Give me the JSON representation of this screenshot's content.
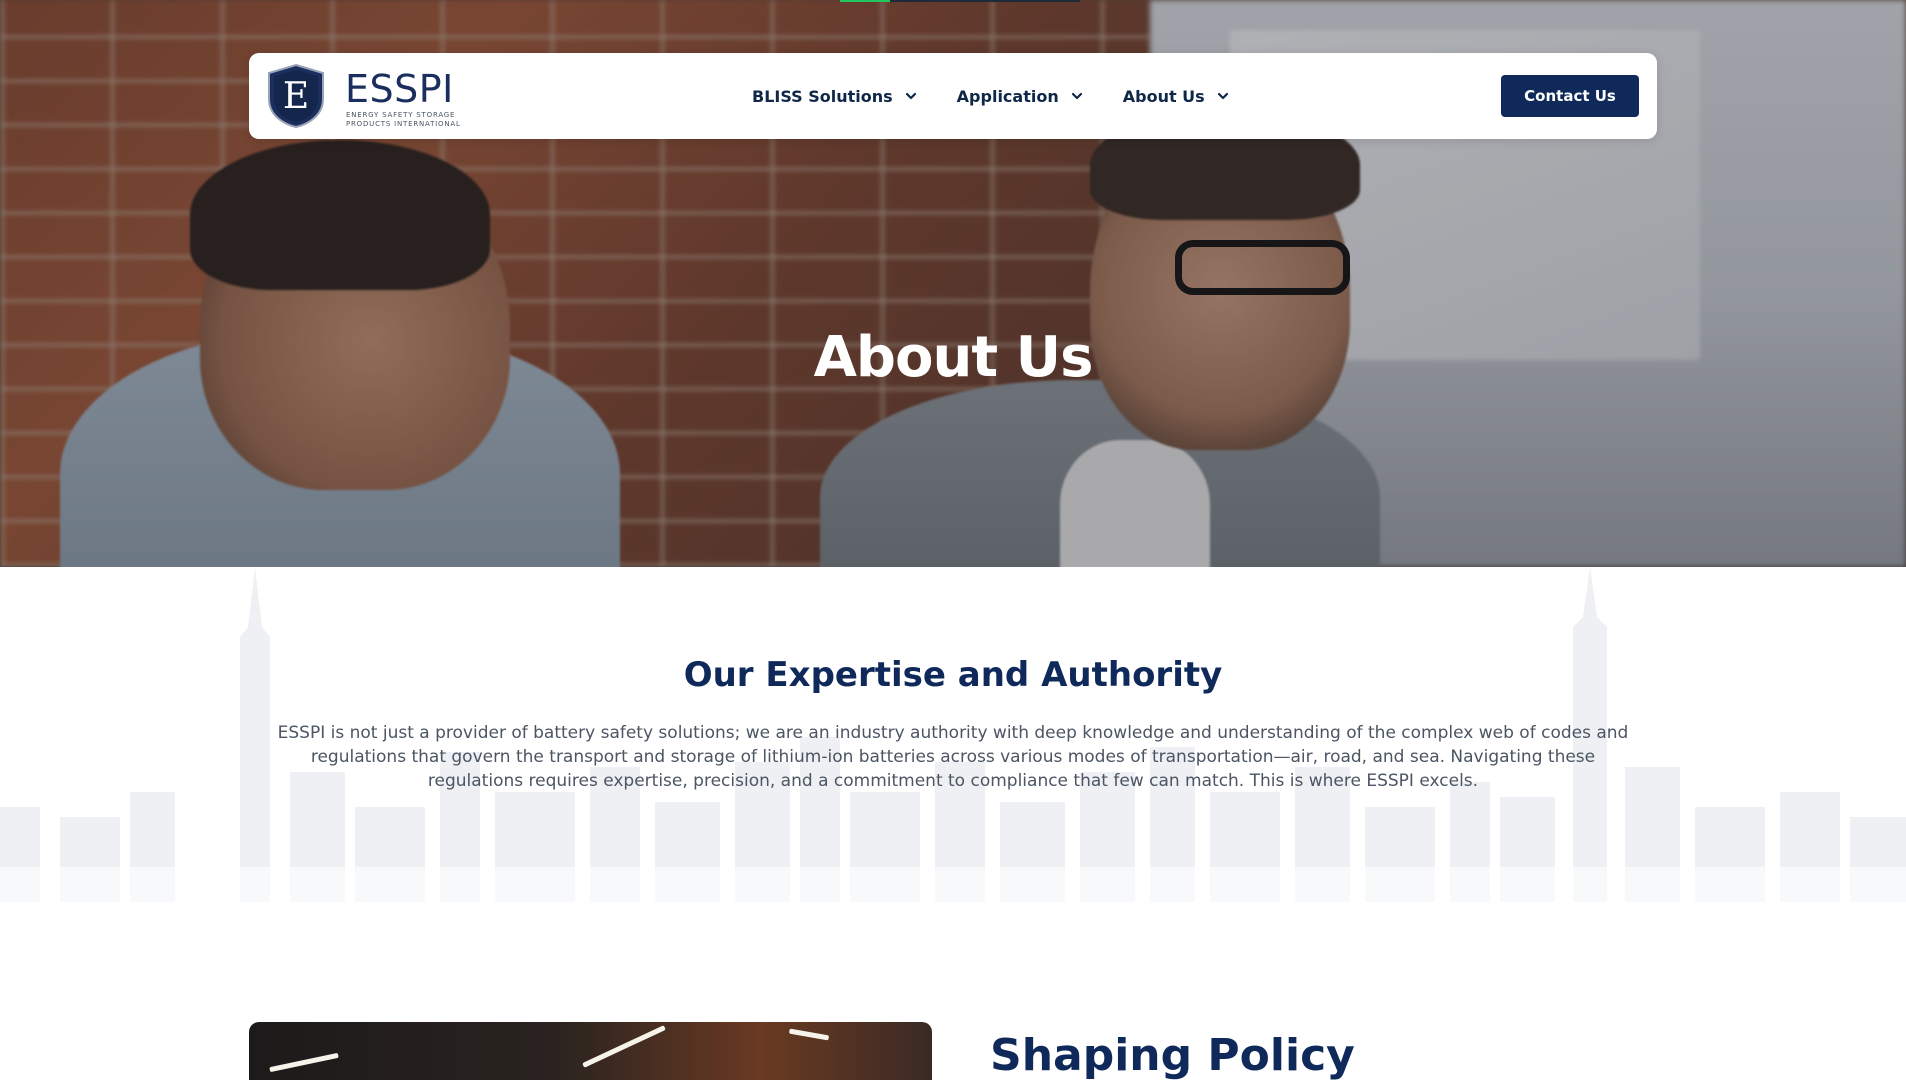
{
  "nav": {
    "logo_text": "ESSPI",
    "logo_letter": "E",
    "logo_tagline_1": "ENERGY SAFETY STORAGE",
    "logo_tagline_2": "PRODUCTS INTERNATIONAL",
    "items": [
      {
        "label": "BLISS Solutions",
        "icon": "chevron-down-icon"
      },
      {
        "label": "Application",
        "icon": "chevron-down-icon"
      },
      {
        "label": "About Us",
        "icon": "chevron-down-icon"
      }
    ],
    "cta_label": "Contact Us"
  },
  "hero": {
    "title": "About Us"
  },
  "expertise": {
    "title": "Our Expertise and Authority",
    "body": "ESSPI is not just a provider of battery safety solutions; we are an industry authority with deep knowledge and understanding of the complex web of codes and regulations that govern the transport and storage of lithium-ion batteries across various modes of transportation—air, road, and sea. Navigating these regulations requires expertise, precision, and a commitment to compliance that few can match. This is where ESSPI excels."
  },
  "policy": {
    "title": "Shaping Policy"
  },
  "colors": {
    "brand_navy": "#0f2a5a",
    "nav_text": "#0f2748",
    "body_text": "#4b5563",
    "progress_accent": "#22c55e"
  }
}
